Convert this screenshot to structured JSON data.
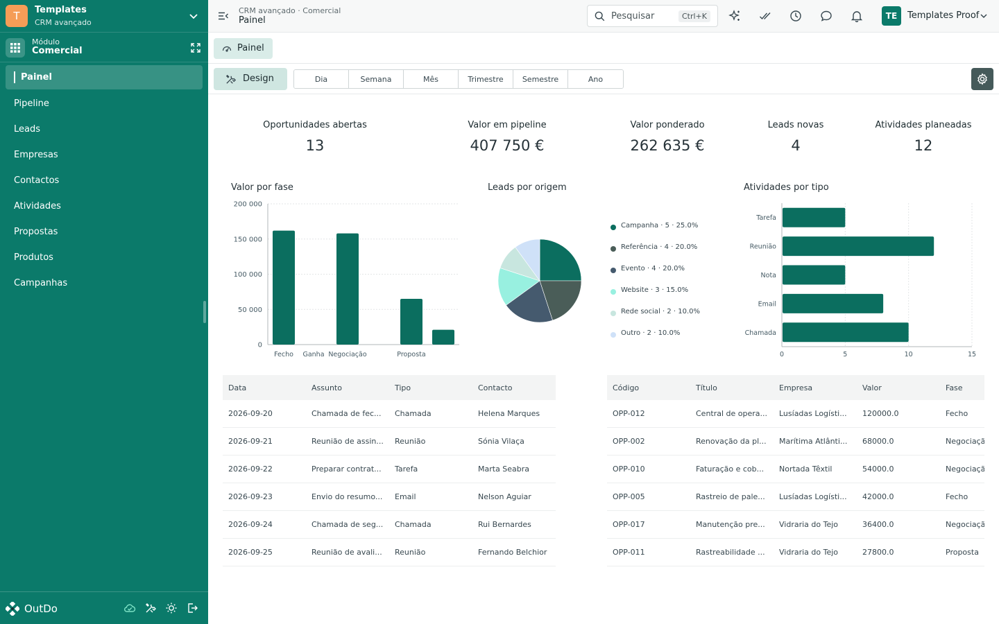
{
  "workspace": {
    "initial": "T",
    "title": "Templates",
    "subtitle": "CRM avançado"
  },
  "module": {
    "label": "Módulo",
    "value": "Comercial"
  },
  "nav": [
    {
      "label": "Painel",
      "active": true
    },
    {
      "label": "Pipeline"
    },
    {
      "label": "Leads"
    },
    {
      "label": "Empresas"
    },
    {
      "label": "Contactos"
    },
    {
      "label": "Atividades"
    },
    {
      "label": "Propostas"
    },
    {
      "label": "Produtos"
    },
    {
      "label": "Campanhas"
    }
  ],
  "footer": {
    "brand": "OutDo",
    "icons": [
      "cloud-check-icon",
      "tools-icon",
      "sun-icon",
      "logout-icon"
    ]
  },
  "topbar": {
    "breadcrumb": "CRM avançado · Comercial",
    "title": "Painel",
    "search_placeholder": "Pesquisar",
    "search_shortcut": "Ctrl+K",
    "icons": [
      "sparkles-icon",
      "double-check-icon",
      "clock-icon",
      "chat-icon",
      "bell-icon"
    ],
    "user_initials": "TE",
    "user_name": "Templates Proof"
  },
  "tab": {
    "label": "Painel"
  },
  "toolbar": {
    "design_label": "Design",
    "periods": [
      "Dia",
      "Semana",
      "Mês",
      "Trimestre",
      "Semestre",
      "Ano"
    ]
  },
  "kpis": [
    {
      "label": "Oportunidades abertas",
      "value": "13"
    },
    {
      "label": "Valor em pipeline",
      "value": "407 750 €"
    },
    {
      "label": "Valor ponderado",
      "value": "262 635 €"
    },
    {
      "label": "Leads novas",
      "value": "4"
    },
    {
      "label": "Atividades planeadas",
      "value": "12"
    }
  ],
  "colors": {
    "primary": "#0b7a6a",
    "sidebar": "#0b7a6a",
    "accent": "#f59d57"
  },
  "chart_data": [
    {
      "type": "bar",
      "title": "Valor por fase",
      "categories": [
        "Fecho",
        "Ganha",
        "Negociação",
        "Proposta",
        ""
      ],
      "tick_labels": [
        "Fecho",
        "Ganha",
        "Negociação",
        "",
        "Proposta",
        ""
      ],
      "values": [
        162000,
        0,
        158000,
        65000,
        21000
      ],
      "bar_slots": [
        0,
        1,
        2,
        4,
        5
      ],
      "ylim": [
        0,
        200000
      ],
      "yticks": [
        "200 000",
        "150 000",
        "100 000",
        "50 000",
        "0"
      ],
      "ytick_values": [
        200000,
        150000,
        100000,
        50000,
        0
      ],
      "grid": true,
      "color": "#0b6e5f"
    },
    {
      "type": "pie",
      "title": "Leads por origem",
      "slices": [
        {
          "label": "Campanha",
          "value": 5,
          "pct": "25.0%",
          "color": "#0b6e5f"
        },
        {
          "label": "Referência",
          "value": 4,
          "pct": "20.0%",
          "color": "#4a5d58"
        },
        {
          "label": "Evento",
          "value": 4,
          "pct": "20.0%",
          "color": "#455a6e"
        },
        {
          "label": "Website",
          "value": 3,
          "pct": "15.0%",
          "color": "#98f0e0"
        },
        {
          "label": "Rede social",
          "value": 2,
          "pct": "10.0%",
          "color": "#c8e6df"
        },
        {
          "label": "Outro",
          "value": 2,
          "pct": "10.0%",
          "color": "#cfe1f8"
        }
      ],
      "legend_position": "right"
    },
    {
      "type": "bar",
      "orientation": "horizontal",
      "title": "Atividades por tipo",
      "categories": [
        "Tarefa",
        "Reunião",
        "Nota",
        "Email",
        "Chamada"
      ],
      "values": [
        5,
        12,
        5,
        8,
        10
      ],
      "xlim": [
        0,
        15
      ],
      "xticks": [
        0,
        5,
        10,
        15
      ],
      "grid": true,
      "color": "#0b6e5f"
    }
  ],
  "activities_table": {
    "columns": [
      "Data",
      "Assunto",
      "Tipo",
      "Contacto"
    ],
    "rows": [
      [
        "2026-09-20",
        "Chamada de fec...",
        "Chamada",
        "Helena Marques"
      ],
      [
        "2026-09-21",
        "Reunião de assin...",
        "Reunião",
        "Sónia Vilaça"
      ],
      [
        "2026-09-22",
        "Preparar contrat...",
        "Tarefa",
        "Marta Seabra"
      ],
      [
        "2026-09-23",
        "Envio do resumo...",
        "Email",
        "Nelson Aguiar"
      ],
      [
        "2026-09-24",
        "Chamada de seg...",
        "Chamada",
        "Rui Bernardes"
      ],
      [
        "2026-09-25",
        "Reunião de avali...",
        "Reunião",
        "Fernando Belchior"
      ]
    ]
  },
  "opportunities_table": {
    "columns": [
      "Código",
      "Título",
      "Empresa",
      "Valor",
      "Fase"
    ],
    "rows": [
      [
        "OPP-012",
        "Central de opera...",
        "Lusíadas Logísti...",
        "120000.0",
        "Fecho"
      ],
      [
        "OPP-002",
        "Renovação da pl...",
        "Marítima Atlânti...",
        "68000.0",
        "Negociação"
      ],
      [
        "OPP-010",
        "Faturação e cob...",
        "Nortada Têxtil",
        "54000.0",
        "Negociação"
      ],
      [
        "OPP-005",
        "Rastreio de pale...",
        "Lusíadas Logísti...",
        "42000.0",
        "Fecho"
      ],
      [
        "OPP-017",
        "Manutenção pre...",
        "Vidraria do Tejo",
        "36400.0",
        "Negociação"
      ],
      [
        "OPP-011",
        "Rastreabilidade ...",
        "Vidraria do Tejo",
        "27800.0",
        "Proposta"
      ]
    ]
  }
}
